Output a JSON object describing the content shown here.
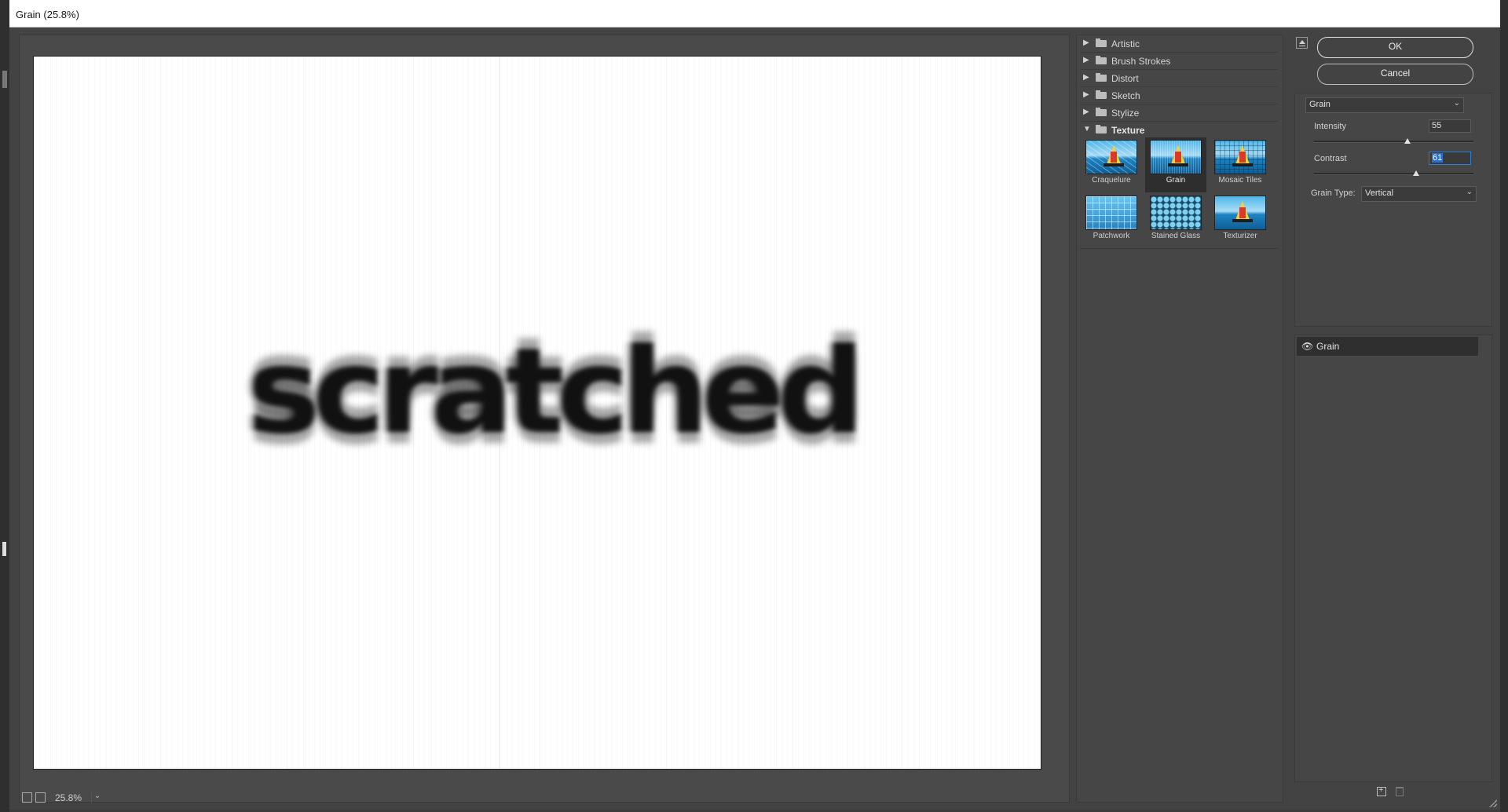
{
  "window": {
    "title": "Grain (25.8%)"
  },
  "preview": {
    "sample_text": "scratched",
    "zoom": "25.8%"
  },
  "gallery": {
    "categories": [
      {
        "label": "Artistic",
        "expanded": false
      },
      {
        "label": "Brush Strokes",
        "expanded": false
      },
      {
        "label": "Distort",
        "expanded": false
      },
      {
        "label": "Sketch",
        "expanded": false
      },
      {
        "label": "Stylize",
        "expanded": false
      },
      {
        "label": "Texture",
        "expanded": true
      }
    ],
    "texture_filters": [
      "Craquelure",
      "Grain",
      "Mosaic Tiles",
      "Patchwork",
      "Stained Glass",
      "Texturizer"
    ],
    "selected_filter": "Grain"
  },
  "buttons": {
    "ok": "OK",
    "cancel": "Cancel"
  },
  "settings": {
    "filter_select": "Grain",
    "intensity_label": "Intensity",
    "intensity_value": "55",
    "intensity_fraction": 0.55,
    "contrast_label": "Contrast",
    "contrast_value": "61",
    "contrast_fraction": 0.61,
    "grain_type_label": "Grain Type:",
    "grain_type_value": "Vertical"
  },
  "effect_layers": [
    {
      "name": "Grain",
      "visible": true
    }
  ],
  "icons": {
    "collapse": "collapse-gallery-icon",
    "eye": "eye-icon",
    "new_layer": "new-effect-layer-icon",
    "delete_layer": "trash-icon",
    "folder": "folder-icon"
  },
  "colors": {
    "selection": "#2c6fd0",
    "canvas": "#ffffff",
    "panel": "#464646"
  }
}
